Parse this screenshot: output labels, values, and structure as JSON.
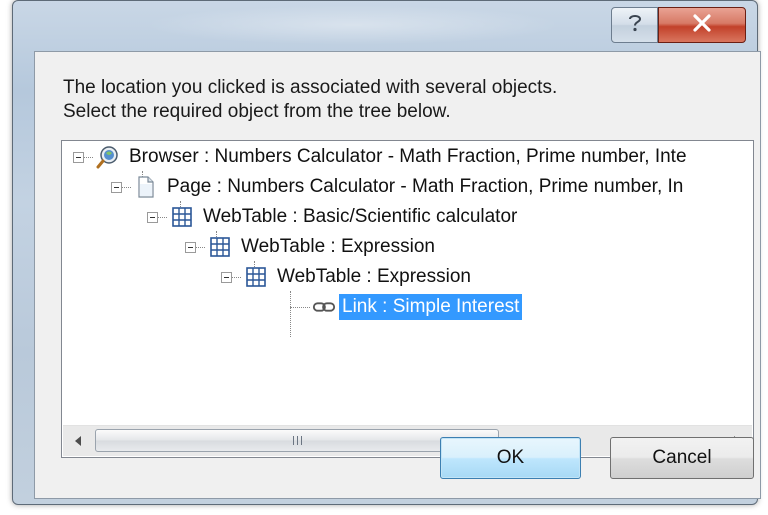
{
  "titlebar": {
    "help_icon": "question-mark-icon",
    "close_icon": "close-x-icon"
  },
  "message": {
    "line1": "The location you clicked is associated with several objects.",
    "line2": "Select the required object from the tree below."
  },
  "tree": {
    "nodes": [
      {
        "icon": "browser-globe-icon",
        "label": "Browser : Numbers Calculator - Math Fraction, Prime number, Inte",
        "expanded": true,
        "selected": false
      },
      {
        "icon": "page-document-icon",
        "label": "Page : Numbers Calculator - Math Fraction, Prime number, In",
        "expanded": true,
        "selected": false
      },
      {
        "icon": "webtable-grid-icon",
        "label": "WebTable : Basic/Scientific calculator",
        "expanded": true,
        "selected": false
      },
      {
        "icon": "webtable-grid-icon",
        "label": "WebTable : Expression",
        "expanded": true,
        "selected": false
      },
      {
        "icon": "webtable-grid-icon",
        "label": "WebTable : Expression",
        "expanded": true,
        "selected": false
      },
      {
        "icon": "link-chain-icon",
        "label": "Link : Simple Interest",
        "expanded": false,
        "selected": true
      }
    ]
  },
  "scrollbar": {
    "left_icon": "scroll-left-arrow-icon",
    "right_icon": "scroll-right-arrow-icon"
  },
  "buttons": {
    "ok": "OK",
    "cancel": "Cancel"
  },
  "colors": {
    "selection": "#3399ff",
    "close_button": "#c2412a",
    "default_button": "#3c7fb1"
  }
}
